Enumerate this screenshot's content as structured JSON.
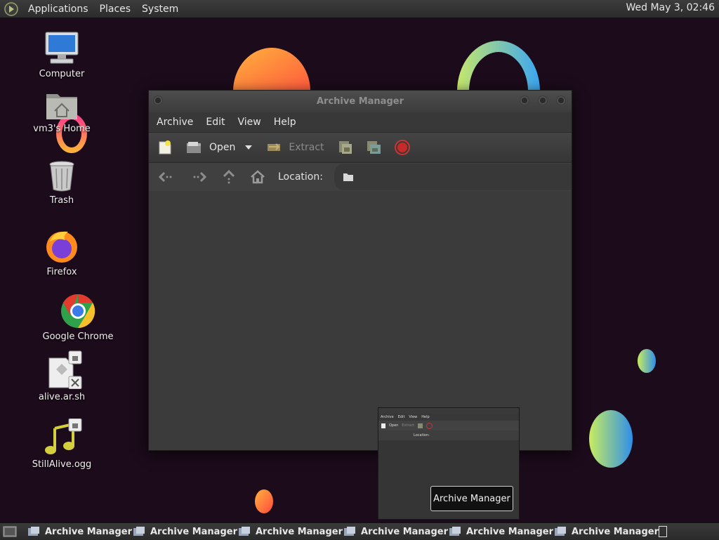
{
  "top_panel": {
    "menus": [
      "Applications",
      "Places",
      "System"
    ],
    "clock": "Wed May  3, 02:46"
  },
  "desktop": {
    "icons": [
      {
        "label": "Computer",
        "icon": "computer-icon"
      },
      {
        "label": "vm3's Home",
        "icon": "home-folder-icon"
      },
      {
        "label": "Trash",
        "icon": "trash-icon"
      },
      {
        "label": "Firefox",
        "icon": "firefox-icon"
      },
      {
        "label": "Google Chrome",
        "icon": "chrome-icon"
      },
      {
        "label": "alive.ar.sh",
        "icon": "script-file-icon"
      },
      {
        "label": "StillAlive.ogg",
        "icon": "audio-file-icon"
      }
    ]
  },
  "window": {
    "title": "Archive Manager",
    "menu": [
      "Archive",
      "Edit",
      "View",
      "Help"
    ],
    "toolbar": {
      "new_icon": "new-archive-icon",
      "open_label": "Open",
      "extract_label": "Extract",
      "add_files_icon": "add-files-icon",
      "add_folder_icon": "add-folder-icon",
      "stop_icon": "stop-icon"
    },
    "location": {
      "label": "Location:",
      "value": ""
    }
  },
  "preview": {
    "tooltip": "Archive Manager",
    "mini_menu": [
      "Archive",
      "Edit",
      "View",
      "Help"
    ],
    "mini_open": "Open",
    "mini_extract": "Extract",
    "mini_location": "Location:"
  },
  "taskbar": {
    "tasks": [
      "Archive Manager",
      "Archive Manager",
      "Archive Manager",
      "Archive Manager",
      "Archive Manager",
      "Archive Manager"
    ]
  },
  "colors": {
    "desktop_bg": "#1c0b1b",
    "window_bg": "#3b3b3b",
    "panel_bg": "#333333"
  }
}
